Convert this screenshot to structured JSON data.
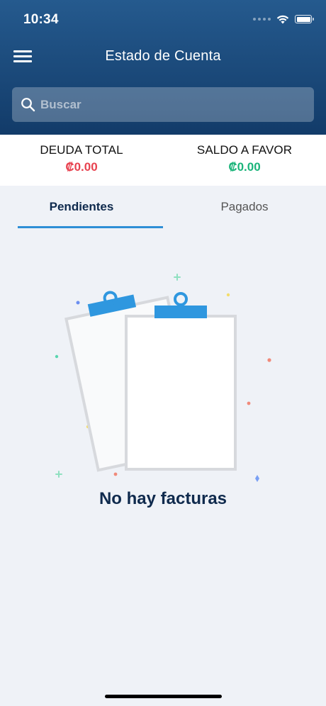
{
  "status_bar": {
    "time": "10:34"
  },
  "header": {
    "title": "Estado de Cuenta",
    "menu_icon": "hamburger-menu-icon"
  },
  "search": {
    "placeholder": "Buscar",
    "value": "",
    "icon": "search-icon"
  },
  "summary": {
    "debt_label": "DEUDA TOTAL",
    "debt_value": "₡0.00",
    "credit_label": "SALDO A FAVOR",
    "credit_value": "₡0.00"
  },
  "tabs": [
    {
      "label": "Pendientes",
      "active": true
    },
    {
      "label": "Pagados",
      "active": false
    }
  ],
  "empty_state": {
    "message": "No hay facturas",
    "illustration": "clipboards-illustration"
  },
  "colors": {
    "header_top": "#255a8e",
    "header_bottom": "#123b69",
    "debt": "#e8424f",
    "credit": "#1bb47a",
    "tab_indicator": "#2e8fd6",
    "title_text": "#0f2a4d",
    "background": "#eff2f7"
  }
}
